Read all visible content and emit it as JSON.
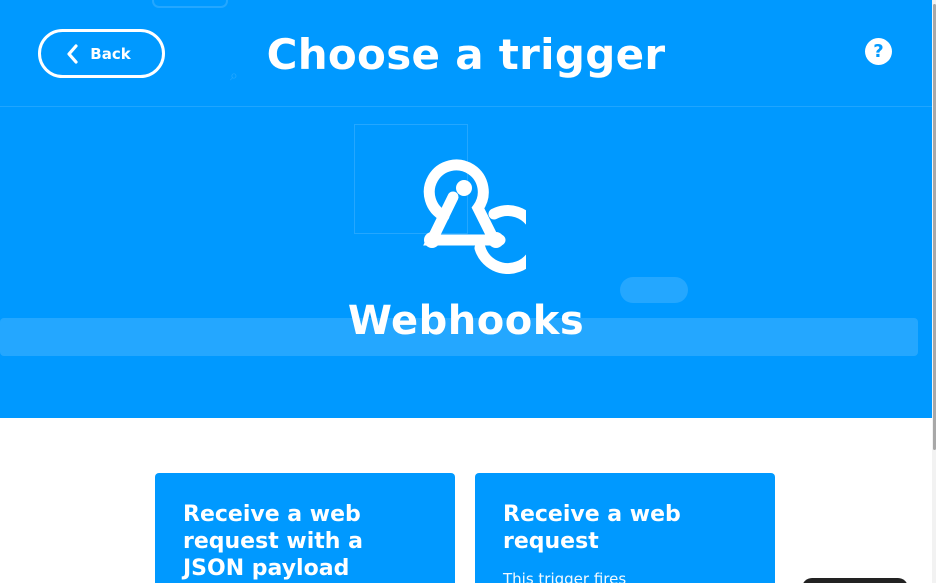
{
  "header": {
    "back_label": "Back",
    "title": "Choose a trigger",
    "help_label": "?"
  },
  "service": {
    "name": "Webhooks",
    "icon": "webhooks-icon"
  },
  "triggers": [
    {
      "title": "Receive a web request with a JSON payload"
    },
    {
      "title": "Receive a web request",
      "description": "This trigger fires"
    }
  ],
  "colors": {
    "brand": "#0099ff",
    "text_on_brand": "#ffffff",
    "background": "#ffffff"
  }
}
